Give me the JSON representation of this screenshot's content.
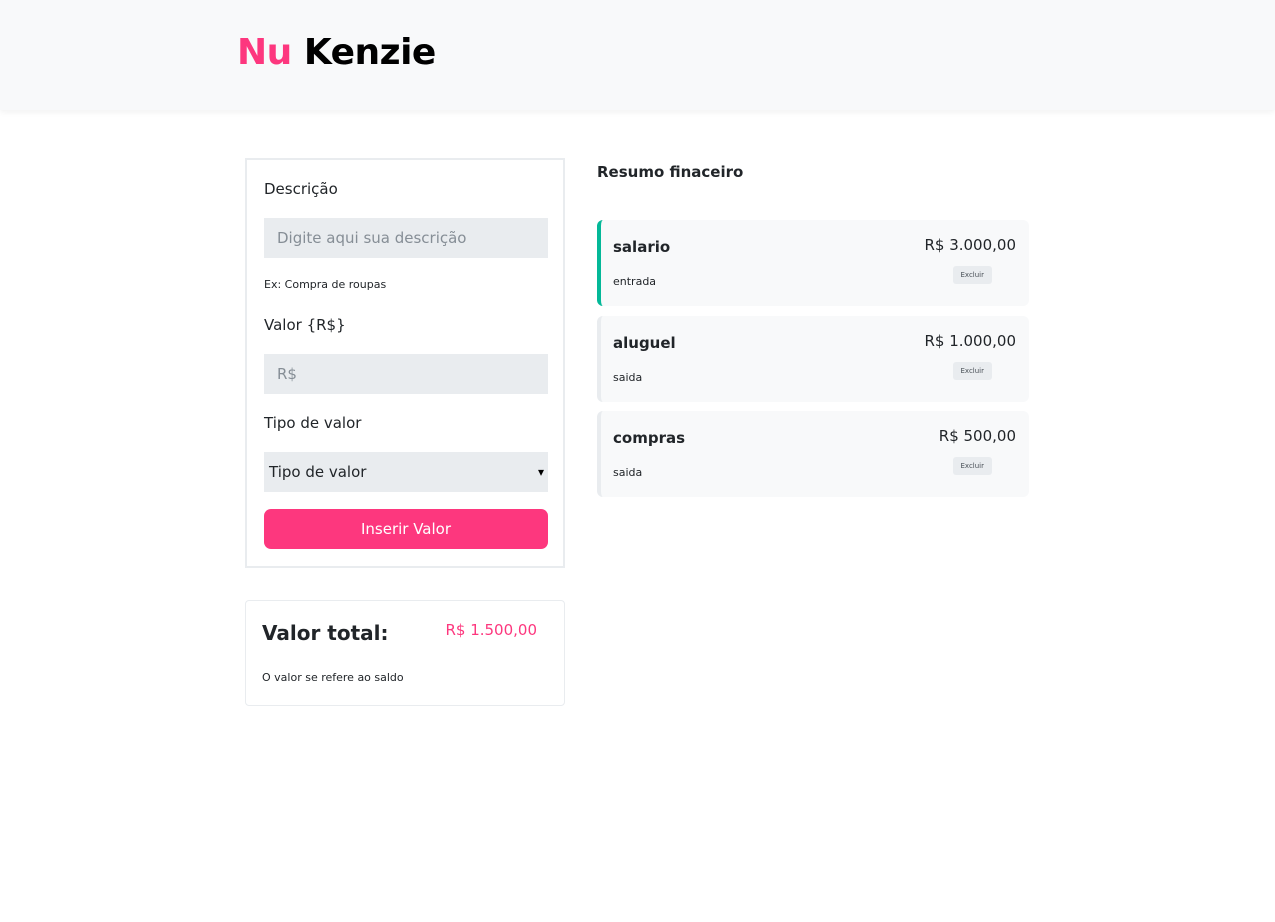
{
  "header": {
    "logo_nu": "Nu",
    "logo_kenzie": "Kenzie"
  },
  "form": {
    "description_label": "Descrição",
    "description_placeholder": "Digite aqui sua descrição",
    "description_hint": "Ex: Compra de roupas",
    "value_label": "Valor {R$}",
    "value_placeholder": "R$",
    "type_label": "Tipo de valor",
    "type_selected": "Tipo de valor",
    "submit_label": "Inserir Valor"
  },
  "total": {
    "title": "Valor total:",
    "value": "R$ 1.500,00",
    "note": "O valor se refere ao saldo"
  },
  "summary": {
    "title": "Resumo finaceiro",
    "entries": [
      {
        "name": "salario",
        "type": "entrada",
        "value": "R$ 3.000,00",
        "delete_label": "Excluir"
      },
      {
        "name": "aluguel",
        "type": "saida",
        "value": "R$ 1.000,00",
        "delete_label": "Excluir"
      },
      {
        "name": "compras",
        "type": "saida",
        "value": "R$ 500,00",
        "delete_label": "Excluir"
      }
    ]
  },
  "colors": {
    "brand": "#fd377e",
    "income": "#03b898",
    "neutral": "#e9ecef"
  }
}
